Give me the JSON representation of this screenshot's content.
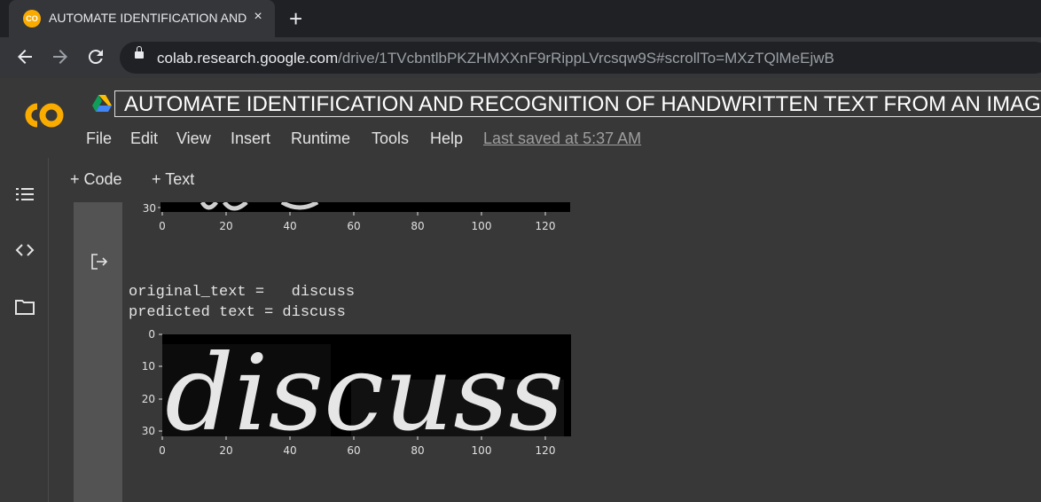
{
  "browser": {
    "tab_title": "AUTOMATE IDENTIFICATION AND RECOGNITION OF HANDWRITTEN TEXT FROM AN IMAGE",
    "tab_favicon_text": "CO",
    "tab_close": "×",
    "new_tab": "+",
    "url_host": "colab.research.google.com",
    "url_path": "/drive/1TVcbntlbPKZHMXXnF9rRippLVrcsqw9S#scrollTo=MXzTQlMeEjwB"
  },
  "header": {
    "logo_text": "CO",
    "notebook_title": "AUTOMATE IDENTIFICATION AND RECOGNITION OF HANDWRITTEN TEXT FROM AN  IMAGE",
    "menu": [
      "File",
      "Edit",
      "View",
      "Insert",
      "Runtime",
      "Tools",
      "Help"
    ],
    "last_saved": "Last saved at 5:37 AM"
  },
  "toolbar": {
    "add_code": "+ Code",
    "add_text": "+ Text"
  },
  "rail_icons": [
    "table-of-contents-icon",
    "code-snippets-icon",
    "files-folder-icon"
  ],
  "output": {
    "original_text_line": "original_text =   discuss",
    "predicted_text_line": "predicted text = discuss",
    "x_ticks": [
      "0",
      "20",
      "40",
      "60",
      "80",
      "100",
      "120"
    ],
    "y_ticks": [
      "0",
      "10",
      "20",
      "30"
    ],
    "prev_plot_y_tick": "30",
    "handwritten_word": "discuss"
  },
  "colors": {
    "tab_bar": "#202124",
    "toolbar": "#35363a",
    "colab_bg": "#383838",
    "logo_orange": "#f9ab00",
    "cell_gutter": "#535353"
  }
}
